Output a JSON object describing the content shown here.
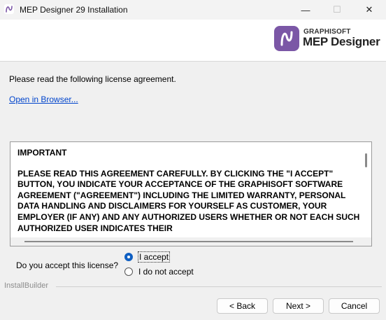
{
  "window": {
    "title": "MEP Designer 29 Installation",
    "controls": {
      "minimize": "—",
      "maximize": "☐",
      "close": "✕"
    }
  },
  "header": {
    "brand_small": "GRAPHISOFT",
    "brand_big": "MEP Designer",
    "logo_color": "#7b57a6"
  },
  "intro_text": "Please read the following license agreement.",
  "open_browser_link": "Open in Browser...",
  "license": {
    "heading": "IMPORTANT",
    "body": "PLEASE READ THIS AGREEMENT CAREFULLY. BY CLICKING THE \"I ACCEPT\" BUTTON, YOU INDICATE YOUR ACCEPTANCE OF THE GRAPHISOFT SOFTWARE AGREEMENT (\"AGREEMENT\") INCLUDING THE LIMITED WARRANTY, PERSONAL DATA HANDLING AND DISCLAIMERS FOR YOURSELF AS CUSTOMER, YOUR EMPLOYER (IF ANY) AND ANY AUTHORIZED USERS WHETHER OR NOT EACH SUCH AUTHORIZED USER INDICATES THEIR"
  },
  "accept_question": "Do you accept this license?",
  "options": {
    "accept": "I accept",
    "decline": "I do not accept",
    "selected": "accept"
  },
  "installbuilder_label": "InstallBuilder",
  "buttons": {
    "back": "< Back",
    "next": "Next >",
    "cancel": "Cancel"
  }
}
